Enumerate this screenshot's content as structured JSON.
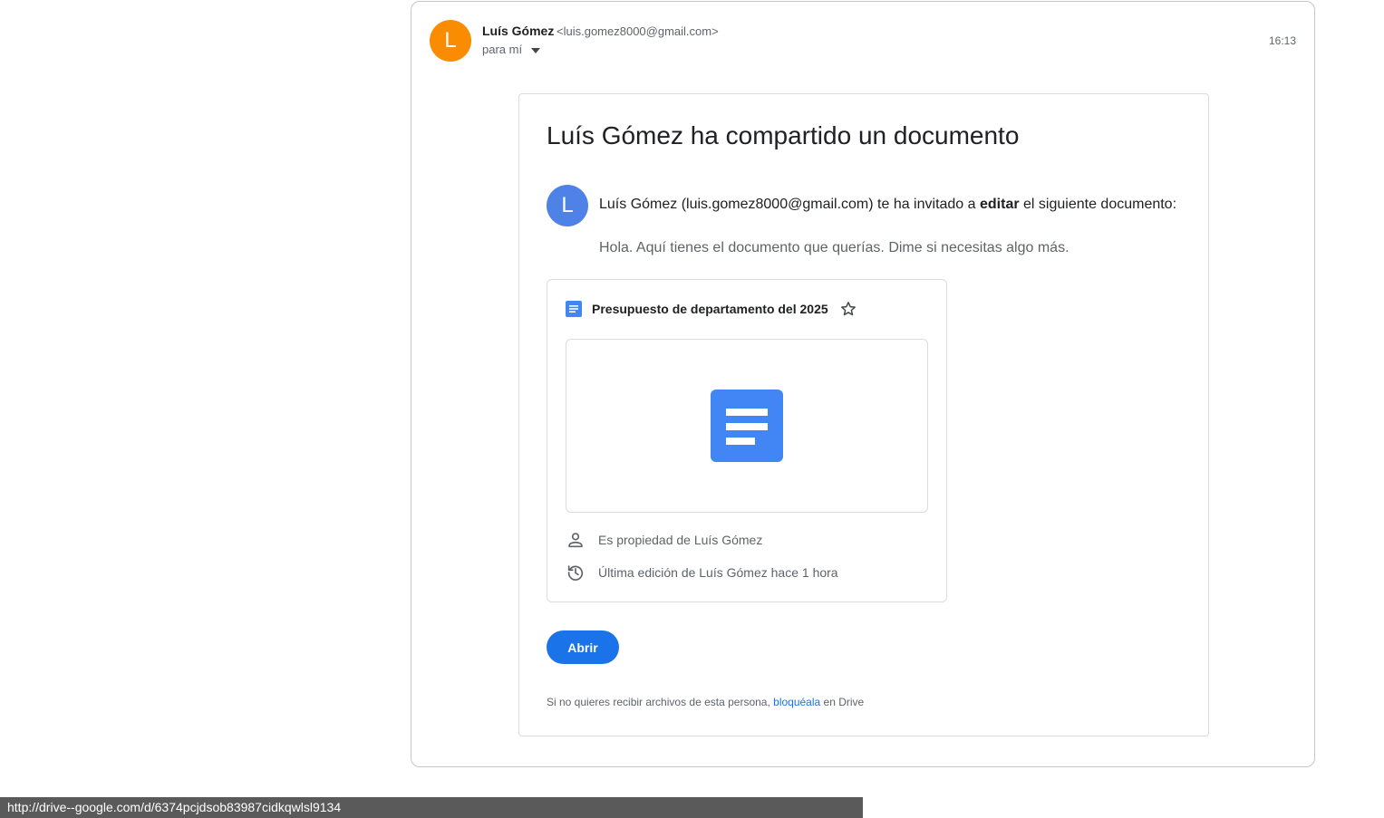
{
  "header": {
    "sender_initial": "L",
    "sender_name": "Luís Gómez",
    "sender_email": "<luis.gomez8000@gmail.com>",
    "recipient": "para mí",
    "time": "16:13",
    "avatar_color": "#f98c00"
  },
  "card": {
    "title": "Luís Gómez ha compartido un documento",
    "inviter_initial": "L",
    "inviter_color": "#4f82e6",
    "invite_prefix": "Luís Gómez (luis.gomez8000@gmail.com) te ha invitado a ",
    "invite_emphasis": "editar",
    "invite_suffix": " el siguiente documento:",
    "message": "Hola. Aquí tienes el documento que querías. Dime si necesitas algo más."
  },
  "document": {
    "name": "Presupuesto de departamento del 2025",
    "owner_text": "Es propiedad de Luís Gómez",
    "edit_text": "Última edición de Luís Gómez hace 1 hora",
    "icon_color": "#4285f4",
    "icons": [
      "google-docs-icon",
      "star-outline-icon",
      "person-icon",
      "history-icon"
    ]
  },
  "actions": {
    "open_label": "Abrir",
    "open_color": "#1a73e8"
  },
  "footer": {
    "prefix": "Si no quieres recibir archivos de esta persona, ",
    "link": "bloquéala",
    "suffix": " en Drive"
  },
  "status_bar": {
    "url": "http://drive--google.com/d/6374pcjdsob83987cidkqwlsl9134"
  }
}
